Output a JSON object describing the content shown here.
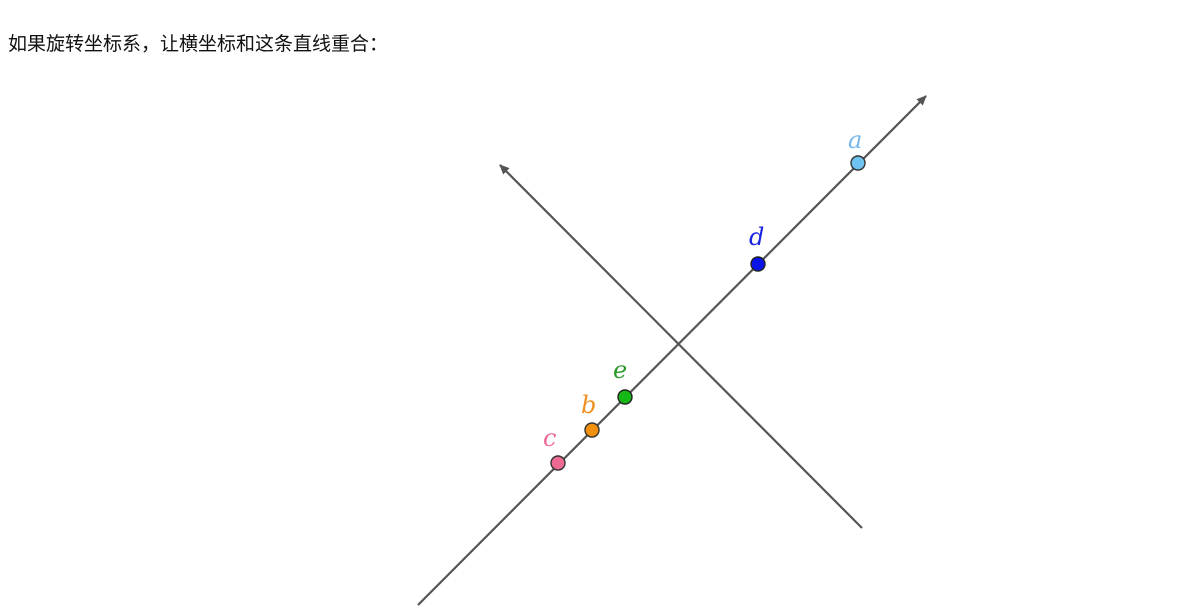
{
  "caption": "如果旋转坐标系，让横坐标和这条直线重合：",
  "axis_color": "#555555",
  "points": [
    {
      "label": "a",
      "color": "#6ec3f0",
      "label_color": "#78b8ea"
    },
    {
      "label": "d",
      "color": "#0a14e8",
      "label_color": "#1a24e0"
    },
    {
      "label": "e",
      "color": "#15b815",
      "label_color": "#2a9a2a"
    },
    {
      "label": "b",
      "color": "#f0900c",
      "label_color": "#f09020"
    },
    {
      "label": "c",
      "color": "#ee6a92",
      "label_color": "#ee6a92"
    }
  ]
}
